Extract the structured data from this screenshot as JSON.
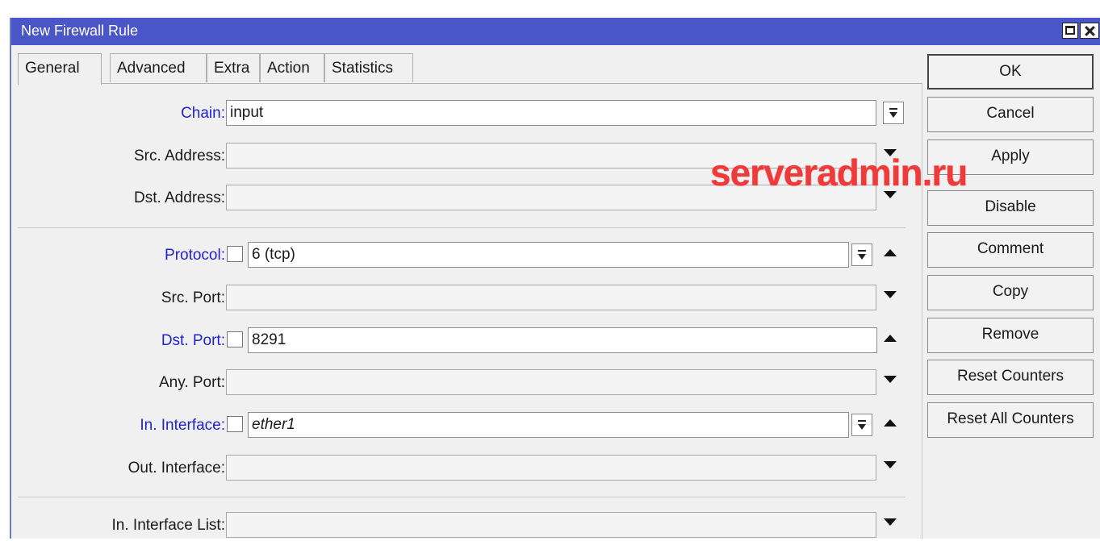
{
  "window": {
    "title": "New Firewall Rule"
  },
  "tabs": [
    "General",
    "Advanced",
    "Extra",
    "Action",
    "Statistics"
  ],
  "fields": {
    "chain": {
      "label": "Chain:",
      "value": "input"
    },
    "src_address": {
      "label": "Src. Address:",
      "value": ""
    },
    "dst_address": {
      "label": "Dst. Address:",
      "value": ""
    },
    "protocol": {
      "label": "Protocol:",
      "value": "6 (tcp)"
    },
    "src_port": {
      "label": "Src. Port:",
      "value": ""
    },
    "dst_port": {
      "label": "Dst. Port:",
      "value": "8291"
    },
    "any_port": {
      "label": "Any. Port:",
      "value": ""
    },
    "in_interface": {
      "label": "In. Interface:",
      "value": "ether1"
    },
    "out_interface": {
      "label": "Out. Interface:",
      "value": ""
    },
    "in_interface_list": {
      "label": "In. Interface List:",
      "value": ""
    }
  },
  "buttons": {
    "ok": "OK",
    "cancel": "Cancel",
    "apply": "Apply",
    "disable": "Disable",
    "comment": "Comment",
    "copy": "Copy",
    "remove": "Remove",
    "reset_counters": "Reset Counters",
    "reset_all_counters": "Reset All Counters"
  },
  "watermark": "serveradmin.ru",
  "colors": {
    "titlebar": "#4a56c8",
    "label_blue": "#2222cc",
    "watermark": "#ee3a3a"
  },
  "icons": [
    "restore-icon",
    "close-icon",
    "dropdown-icon",
    "arrow-down-icon",
    "arrow-up-icon"
  ]
}
